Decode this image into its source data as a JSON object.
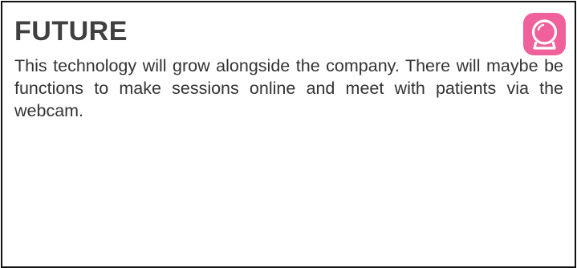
{
  "card": {
    "title": "FUTURE",
    "body": "This technology will grow alongside the company. There will maybe be functions to make sessions online and meet with patients via the webcam."
  },
  "icon": {
    "name": "crystal-ball-app-icon",
    "background": "#f0609a",
    "foreground": "#ffffff"
  },
  "colors": {
    "border": "#111111",
    "title": "#404040",
    "text": "#333333"
  }
}
